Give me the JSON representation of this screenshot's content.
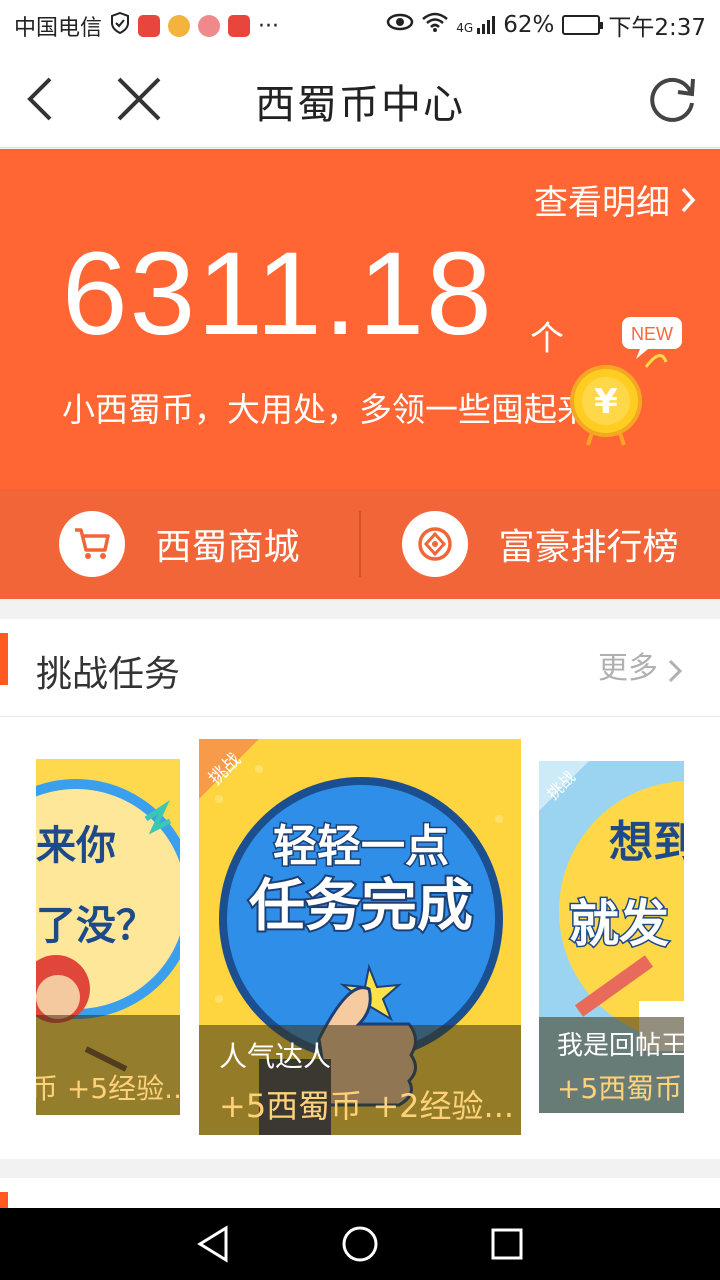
{
  "status_bar": {
    "carrier": "中国电信",
    "network": "4G",
    "battery": "62%",
    "battery_level": 0.62,
    "time": "下午2:37"
  },
  "nav": {
    "title": "西蜀币中心"
  },
  "hero": {
    "detail_link": "查看明细",
    "balance": "6311.18",
    "unit": "个",
    "slogan": "小西蜀币，大用处，多领一些囤起来!",
    "badge": "NEW",
    "coin_symbol": "¥"
  },
  "quick_links": [
    {
      "label": "西蜀商城",
      "icon": "cart-icon"
    },
    {
      "label": "富豪排行榜",
      "icon": "ranking-icon"
    }
  ],
  "challenge": {
    "title": "挑战任务",
    "more": "更多",
    "cards": [
      {
        "name": "",
        "art_text_1": "来你",
        "art_text_2": "了没？",
        "reward": "币 +5经验..."
      },
      {
        "name": "人气达人",
        "tag": "挑战",
        "art_text_1": "轻轻一点",
        "art_text_2": "任务完成",
        "reward": "+5西蜀币 +2经验..."
      },
      {
        "name": "我是回帖王",
        "tag": "挑战",
        "art_text_1": "想到",
        "art_text_2": "就发",
        "reward": "+5西蜀币"
      }
    ]
  },
  "colors": {
    "accent": "#ff6633",
    "accent_dark": "#f26538",
    "card_yellow": "#ffd53f",
    "card_blue": "#2f8fe8"
  }
}
